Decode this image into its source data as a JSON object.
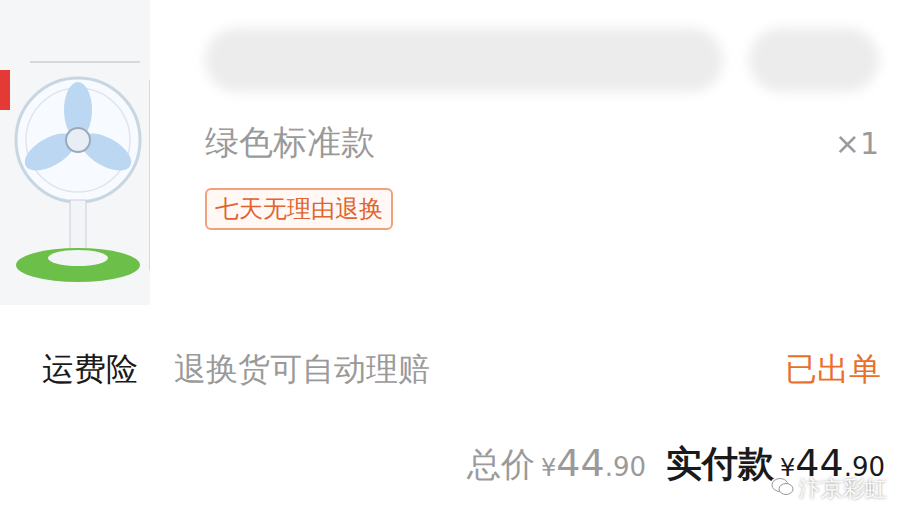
{
  "product": {
    "variant": "绿色标准款",
    "quantity": "×1",
    "badge": "七天无理由退换"
  },
  "insurance": {
    "label": "运费险",
    "description": "退换货可自动理赔",
    "status": "已出单"
  },
  "totals": {
    "total_label": "总价",
    "total_currency": "¥",
    "total_integer": "44",
    "total_decimal": ".90",
    "paid_label": "实付款",
    "paid_currency": "¥",
    "paid_integer": "44",
    "paid_decimal": ".90"
  },
  "watermark": "汴京彩虹"
}
